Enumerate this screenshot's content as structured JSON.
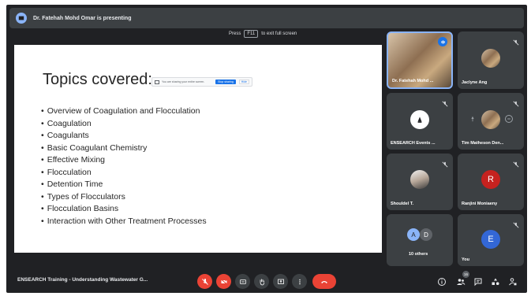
{
  "presenting_bar": {
    "text": "Dr. Fatehah Mohd Omar is presenting"
  },
  "fullscreen_hint": {
    "pre": "Press",
    "key": "F11",
    "post": "to exit full screen"
  },
  "slide": {
    "title": "Topics covered:",
    "share_popup": {
      "text": "You are sharing your entire screen.",
      "stop_label": "Stop sharing",
      "hide_label": "Hide"
    },
    "bullets": [
      "Overview of Coagulation and Flocculation",
      "Coagulation",
      "Coagulants",
      "Basic Coagulant Chemistry",
      "Effective Mixing",
      "Flocculation",
      "Detention Time",
      "Types of Flocculators",
      "Flocculation Basins",
      "Interaction with Other Treatment Processes"
    ]
  },
  "participants": {
    "presenter": "Dr. Fatehah Mohd ...",
    "jaclyne": "Jaclyne Ang",
    "ensearch": "ENSEARCH Events ...",
    "tim": "Tim Matheson Den...",
    "shouldel": "Shouldel T.",
    "ranjini": {
      "name": "Ranjini Moniaeny",
      "initial": "R"
    },
    "others": {
      "label": "10 others",
      "initial_a": "A",
      "initial_d": "D"
    },
    "you": {
      "name": "You",
      "initial": "E"
    }
  },
  "meeting": {
    "title": "ENSEARCH Training - Understanding Wastewater G...",
    "participant_count": "16"
  },
  "colors": {
    "background": "#202124",
    "tile": "#3c4043",
    "red": "#ea4335",
    "blue": "#8ab4f8"
  }
}
